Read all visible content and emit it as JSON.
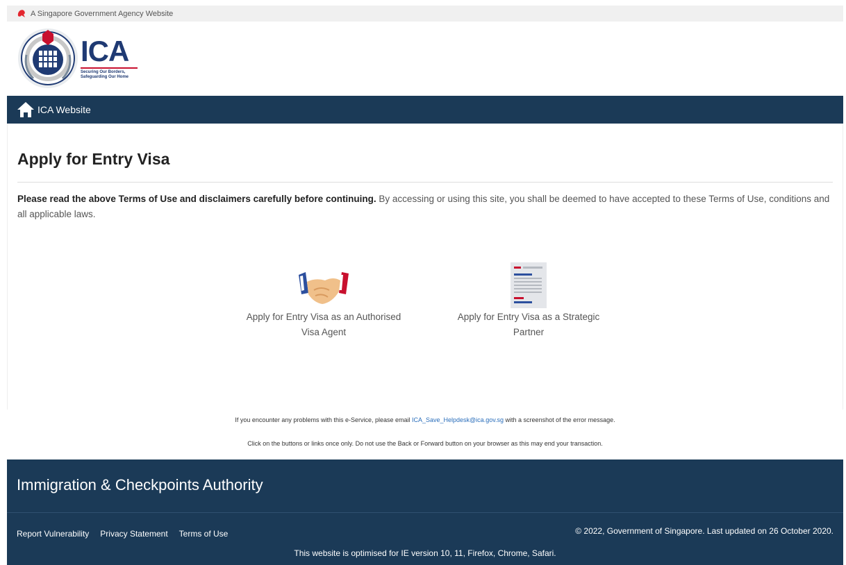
{
  "masthead": {
    "text": "A Singapore Government Agency Website"
  },
  "logo": {
    "name": "ICA",
    "tagline_1": "Securing Our Borders,",
    "tagline_2": "Safeguarding Our Home"
  },
  "nav": {
    "home_label": "ICA Website"
  },
  "main": {
    "title": "Apply for Entry Visa",
    "notice_bold": "Please read the above Terms of Use and disclaimers carefully before continuing.",
    "notice_text": " By accessing or using this site, you shall be deemed to have accepted to these Terms of Use, conditions and all applicable laws.",
    "options": [
      {
        "label": "Apply for Entry Visa as an Authorised Visa Agent",
        "icon": "handshake-icon"
      },
      {
        "label": "Apply for Entry Visa as a Strategic Partner",
        "icon": "document-icon"
      }
    ]
  },
  "help": {
    "line1_pre": "If you encounter any problems with this e-Service, please email ",
    "email": "ICA_Save_Helpdesk@ica.gov.sg",
    "line1_post": " with a screenshot of the error message.",
    "line2": "Click on the buttons or links once only. Do not use the Back or Forward button on your browser as this may end your transaction."
  },
  "footer": {
    "title": "Immigration & Checkpoints Authority",
    "links": [
      "Report Vulnerability",
      "Privacy Statement",
      "Terms of Use"
    ],
    "copyright": "© 2022, Government of Singapore. Last updated on 26 October 2020.",
    "optimised": "This website is optimised for IE version 10, 11, Firefox, Chrome, Safari."
  },
  "colors": {
    "navy": "#1b3a57",
    "brand_red": "#c8102e",
    "link": "#2a6ebb"
  }
}
